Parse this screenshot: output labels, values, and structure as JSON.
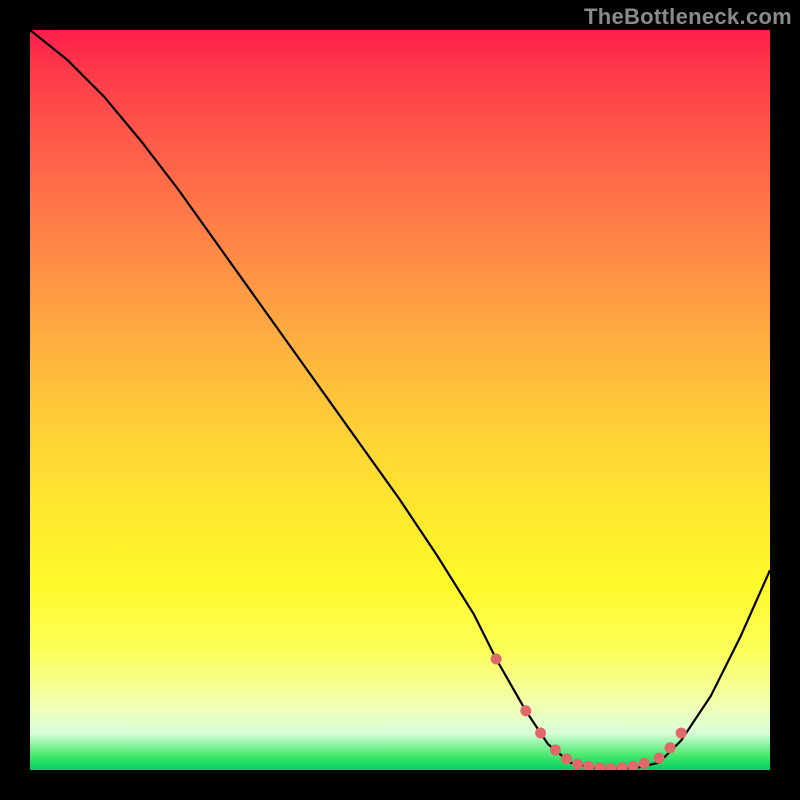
{
  "watermark": "TheBottleneck.com",
  "chart_data": {
    "type": "line",
    "title": "",
    "xlabel": "",
    "ylabel": "",
    "xlim": [
      0,
      100
    ],
    "ylim": [
      0,
      100
    ],
    "grid": false,
    "legend": false,
    "series": [
      {
        "name": "bottleneck-curve",
        "color": "#000000",
        "x": [
          0,
          5,
          10,
          15,
          20,
          25,
          30,
          35,
          40,
          45,
          50,
          55,
          60,
          63,
          67,
          70,
          73,
          76,
          79,
          82,
          85,
          88,
          92,
          96,
          100
        ],
        "y": [
          100,
          96,
          91,
          85,
          78.5,
          71.5,
          64.5,
          57.5,
          50.5,
          43.5,
          36.5,
          29,
          21,
          15,
          8,
          3.5,
          1.0,
          0.3,
          0.2,
          0.3,
          1.0,
          4,
          10,
          18,
          27
        ]
      },
      {
        "name": "highlight-dots",
        "color": "#e06a6a",
        "type": "scatter",
        "x": [
          63,
          67,
          69,
          71,
          72.5,
          74,
          75.5,
          77,
          78.5,
          80,
          81.5,
          83,
          85,
          86.5,
          88
        ],
        "y": [
          15,
          8,
          5,
          2.7,
          1.5,
          0.8,
          0.5,
          0.3,
          0.25,
          0.3,
          0.5,
          0.9,
          1.6,
          3,
          5
        ]
      }
    ],
    "background_gradient": {
      "orientation": "vertical",
      "stops": [
        {
          "pos": 0.0,
          "color": "#ff1e4a"
        },
        {
          "pos": 0.15,
          "color": "#ff5a4a"
        },
        {
          "pos": 0.35,
          "color": "#ff9944"
        },
        {
          "pos": 0.55,
          "color": "#ffd336"
        },
        {
          "pos": 0.75,
          "color": "#fff92a"
        },
        {
          "pos": 0.92,
          "color": "#f0ffc0"
        },
        {
          "pos": 1.0,
          "color": "#00d060"
        }
      ]
    }
  }
}
